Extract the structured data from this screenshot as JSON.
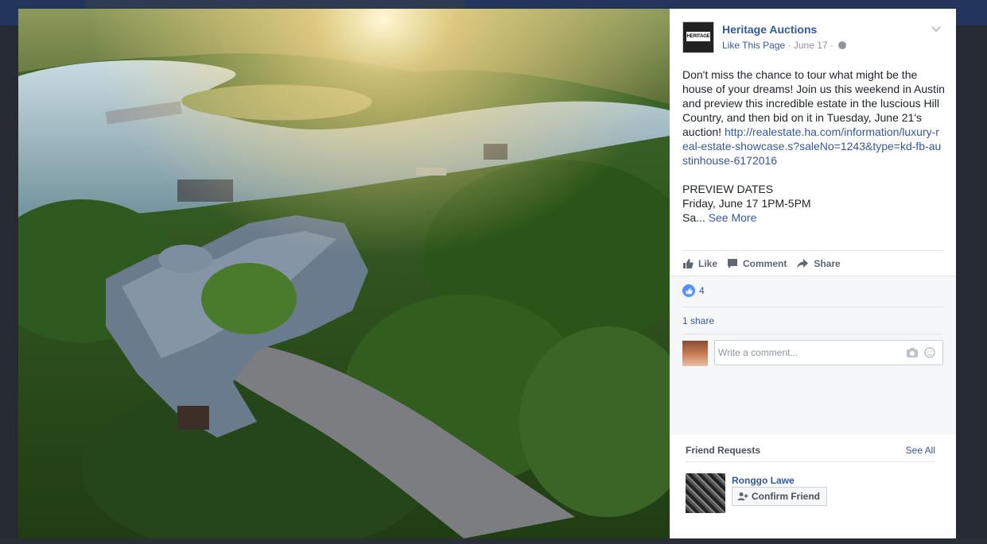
{
  "post": {
    "page_name": "Heritage Auctions",
    "logo_text": "HERITAGE",
    "like_page": "Like This Page",
    "date": "· June 17 ·",
    "body_line1": "Don't miss the chance to tour what might be the house of your dreams! Join us this weekend in Austin and preview this incredible estate in the luscious Hill Country, and then bid on it in Tuesday, June 21's auction!",
    "link": "http://realestate.ha.com/information/luxury-real-estate-showcase.s?saleNo=1243&type=kd-fb-austinhouse-6172016",
    "preview_heading": "PREVIEW DATES",
    "preview_line": "Friday, June 17 1PM-5PM",
    "truncated": "Sa...",
    "see_more": "See More"
  },
  "actions": {
    "like": "Like",
    "comment": "Comment",
    "share": "Share"
  },
  "feedback": {
    "reaction_count": "4",
    "shares": "1 share",
    "comment_placeholder": "Write a comment..."
  },
  "friend_requests": {
    "title": "Friend Requests",
    "see_all": "See All",
    "items": [
      {
        "name": "Ronggo Lawe",
        "button": "Confirm Friend"
      }
    ]
  },
  "icons": {
    "globe": "globe-icon",
    "chevron": "chevron-down-icon",
    "like": "thumbs-up-icon",
    "comment": "comment-bubble-icon",
    "share": "share-arrow-icon",
    "camera": "camera-icon",
    "emoji": "emoji-icon",
    "add_friend": "add-friend-icon"
  },
  "colors": {
    "link": "#365899",
    "like_bubble": "#5890ff",
    "meta": "#90949c"
  }
}
